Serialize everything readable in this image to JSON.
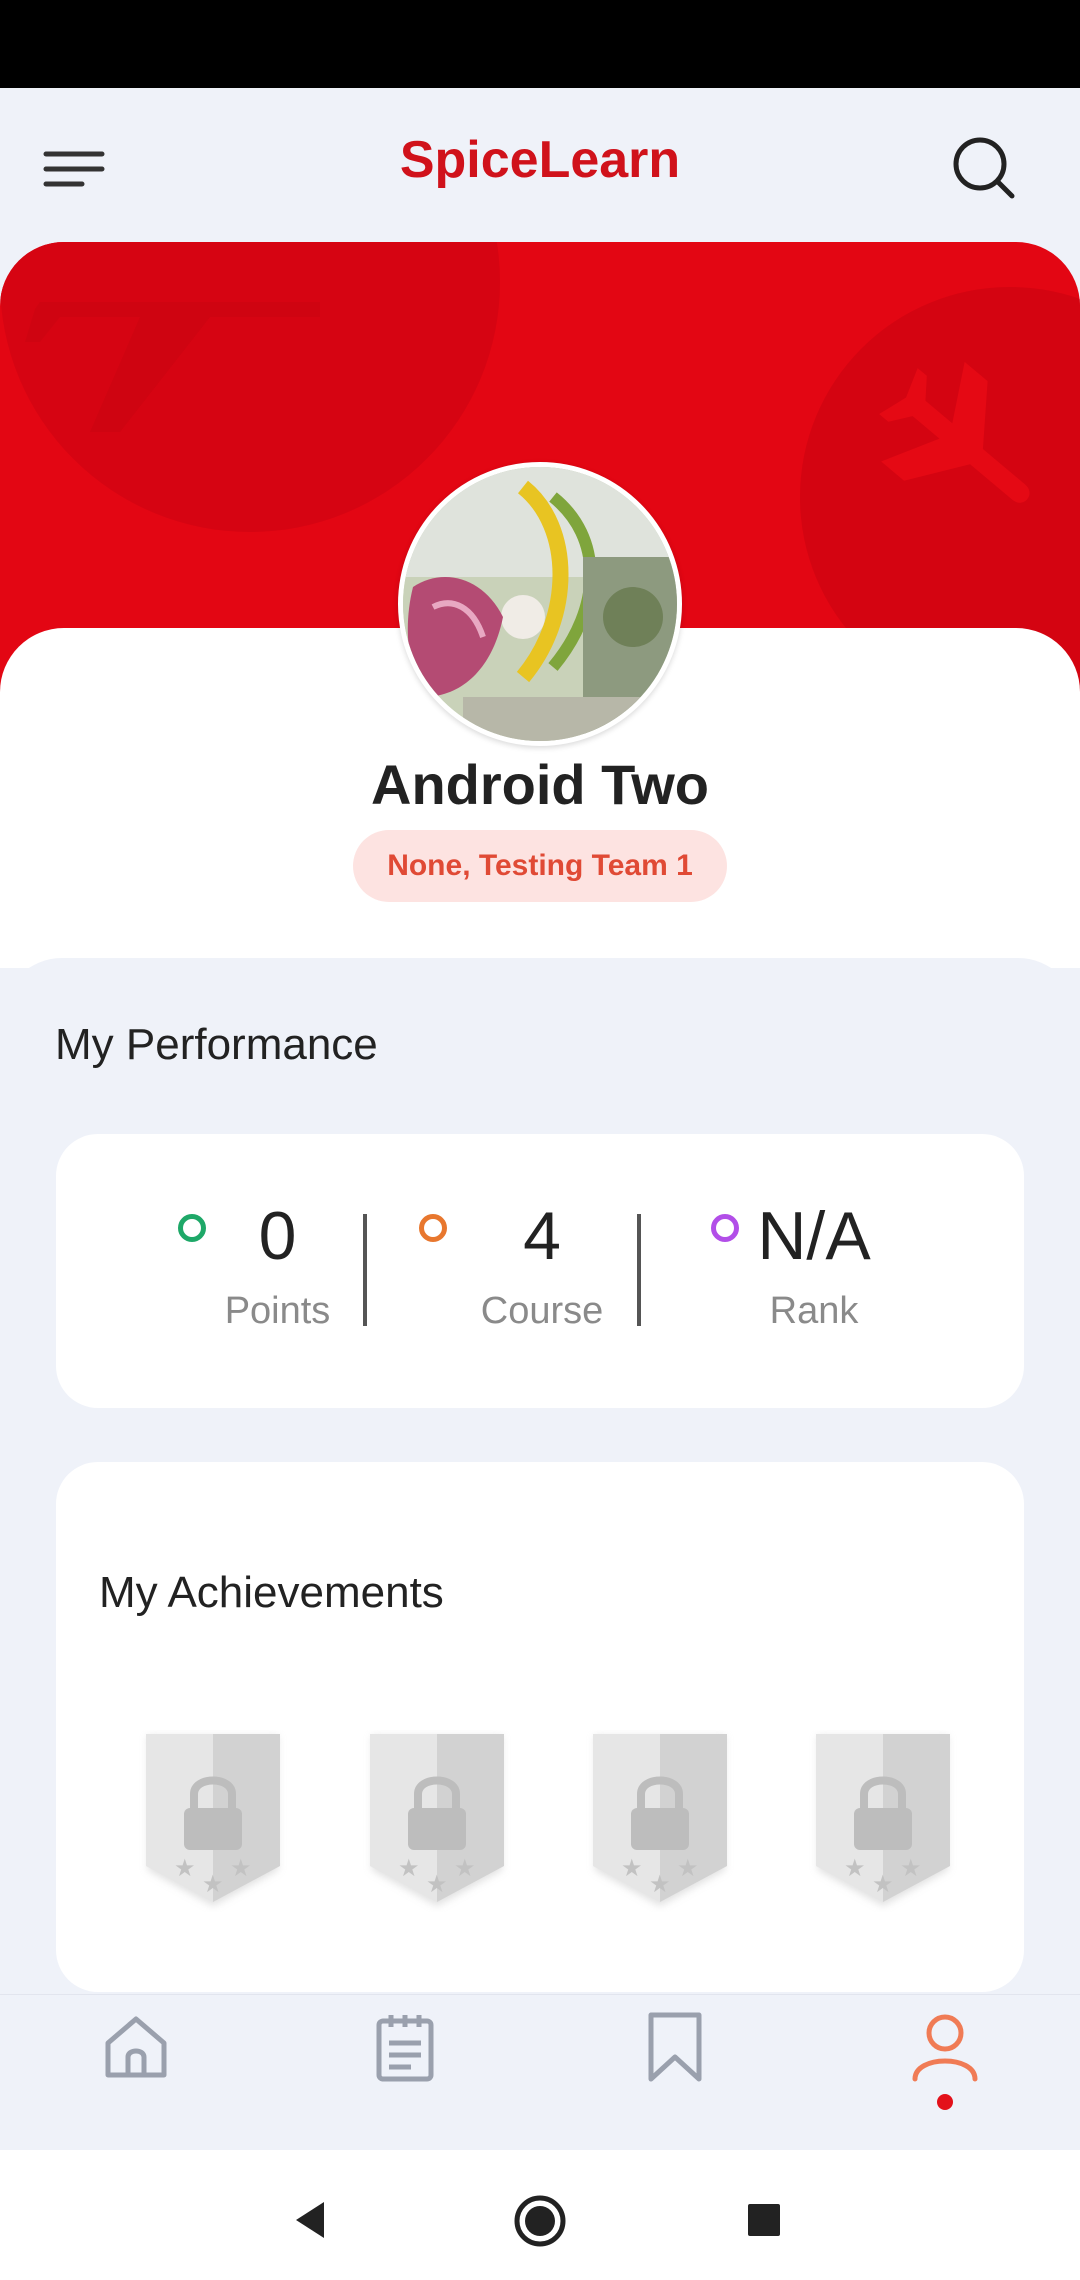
{
  "app": {
    "title": "SpiceLearn"
  },
  "profile": {
    "name": "Android Two",
    "team": "None, Testing Team 1"
  },
  "performance": {
    "title": "My Performance",
    "stats": [
      {
        "value": "0",
        "label": "Points",
        "color": "#1ea868"
      },
      {
        "value": "4",
        "label": "Course",
        "color": "#e8772e"
      },
      {
        "value": "N/A",
        "label": "Rank",
        "color": "#b24ee8"
      }
    ]
  },
  "achievements": {
    "title": "My Achievements",
    "badges": [
      "locked-badge-icon",
      "locked-badge-icon",
      "locked-badge-icon",
      "locked-badge-icon"
    ]
  },
  "bottom_nav": {
    "items": [
      "home-icon",
      "notepad-icon",
      "bookmark-icon",
      "profile-icon"
    ],
    "active": 3
  },
  "colors": {
    "brand": "#d0121b",
    "hero": "#e30613",
    "background": "#eff2f9",
    "active_nav": "#f07b55"
  }
}
